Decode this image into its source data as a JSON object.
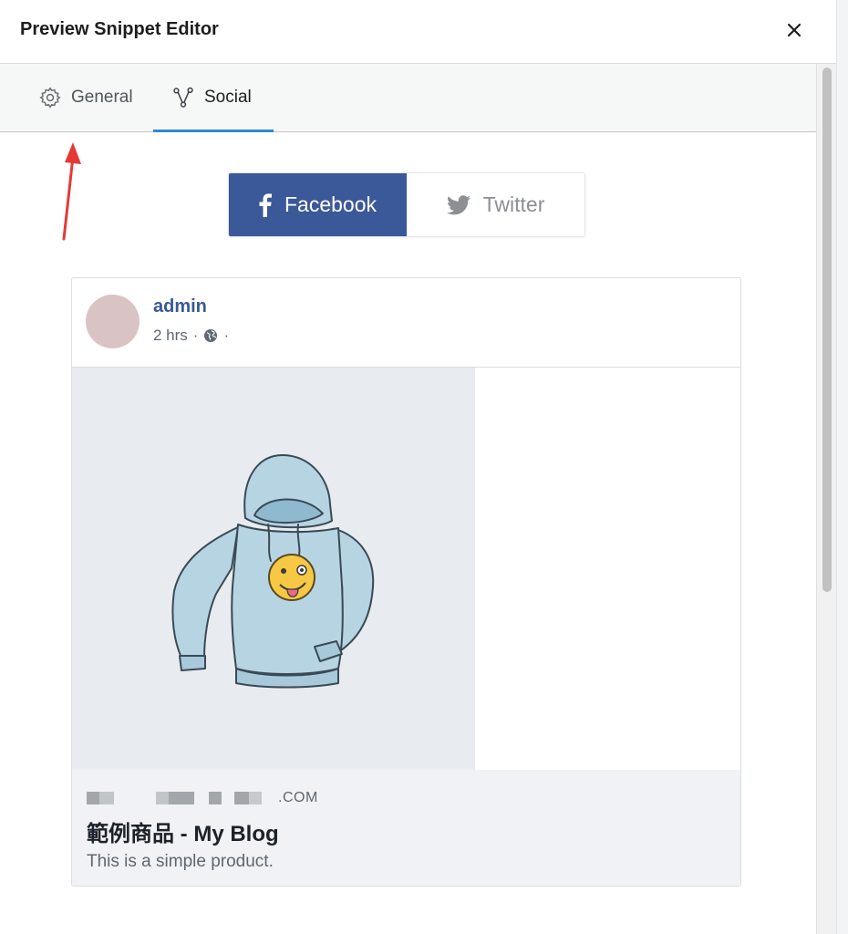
{
  "header": {
    "title": "Preview Snippet Editor",
    "close_icon": "close-icon"
  },
  "tabs": [
    {
      "label": "General",
      "icon": "gear-icon",
      "active": false
    },
    {
      "label": "Social",
      "icon": "share-nodes-icon",
      "active": true
    }
  ],
  "network_toggle": {
    "options": [
      {
        "label": "Facebook",
        "icon": "facebook-icon",
        "selected": true
      },
      {
        "label": "Twitter",
        "icon": "twitter-icon",
        "selected": false
      }
    ]
  },
  "facebook_preview": {
    "author": "admin",
    "time": "2 hrs",
    "separator": "·",
    "visibility_icon": "globe-icon",
    "image": "hoodie-with-winking-emoji-illustration",
    "domain_suffix": ".COM",
    "title": "範例商品 - My Blog",
    "description": "This is a simple product."
  },
  "colors": {
    "facebook_blue": "#3b5998",
    "active_tab_underline": "#2b8ccf",
    "author_link": "#385898",
    "annotation_arrow": "#e53935"
  }
}
